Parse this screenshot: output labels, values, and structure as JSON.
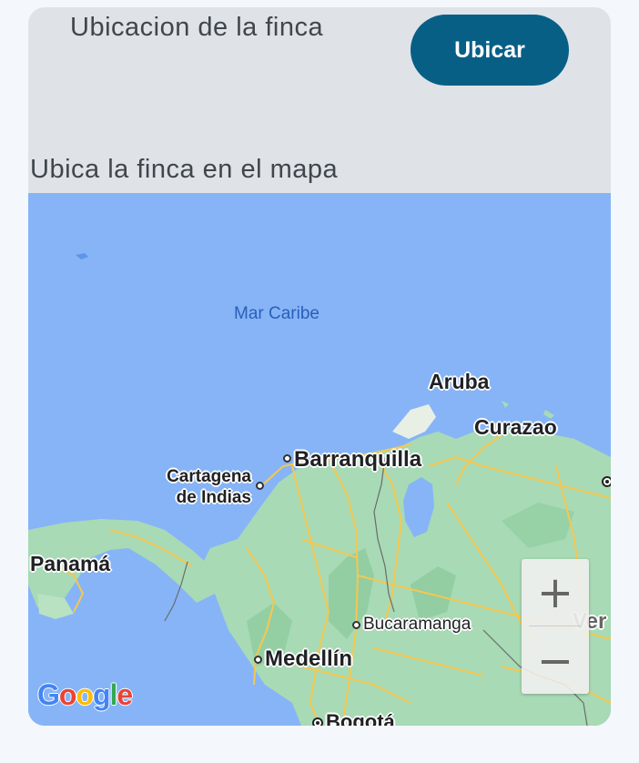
{
  "header": {
    "title": "Ubicacion de la finca",
    "locate_button": "Ubicar"
  },
  "map_section": {
    "prompt": "Ubica la finca en el mapa"
  },
  "map": {
    "sea_label": "Mar Caribe",
    "places": {
      "aruba": "Aruba",
      "curazao": "Curazao",
      "barranquilla": "Barranquilla",
      "cartagena": "Cartagena\nde Indias",
      "panama": "Panamá",
      "bucaramanga": "Bucaramanga",
      "medellin": "Medellín",
      "bogota": "Bogotá",
      "venezuela_partial": "Ver"
    },
    "zoom_in_label": "+",
    "zoom_out_label": "−",
    "attribution_logo": "Google",
    "colors": {
      "water": "#86b4f7",
      "land": "#a8dab5",
      "roads": "#f6c74f",
      "accent_button": "#075f86"
    }
  }
}
